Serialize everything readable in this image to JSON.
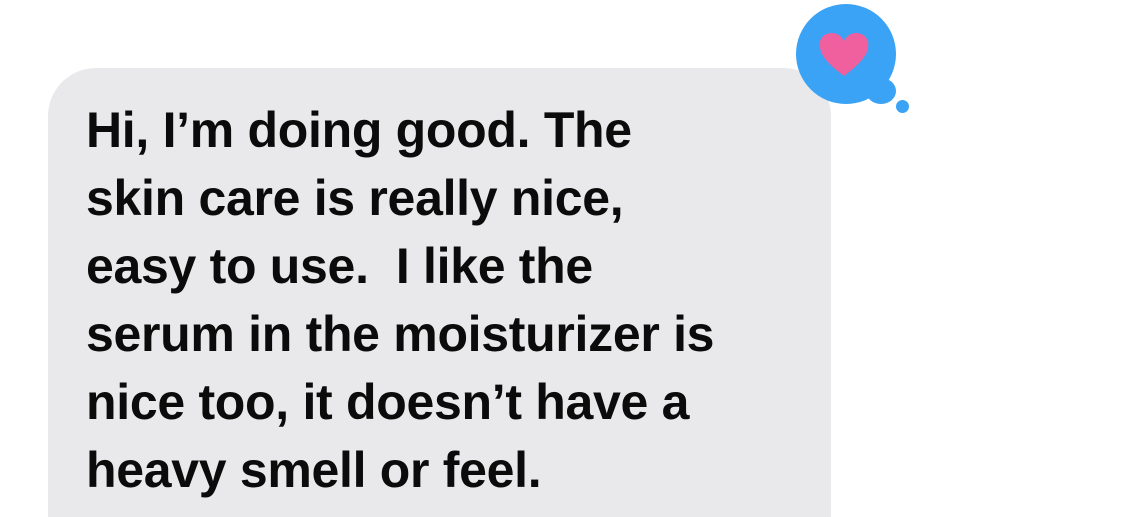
{
  "message": {
    "lines": [
      "Hi, I’m doing good. The",
      "skin care is really nice,",
      "easy to use.  I like the",
      "serum in the moisturizer is",
      "nice too, it doesn’t have a",
      "heavy smell or feel."
    ],
    "bubble_color": "#e9e9eb",
    "text_color": "#0b0b0b"
  },
  "tapback": {
    "icon": "heart-icon",
    "badge_color": "#3ba3f5",
    "heart_color": "#f0609e"
  }
}
